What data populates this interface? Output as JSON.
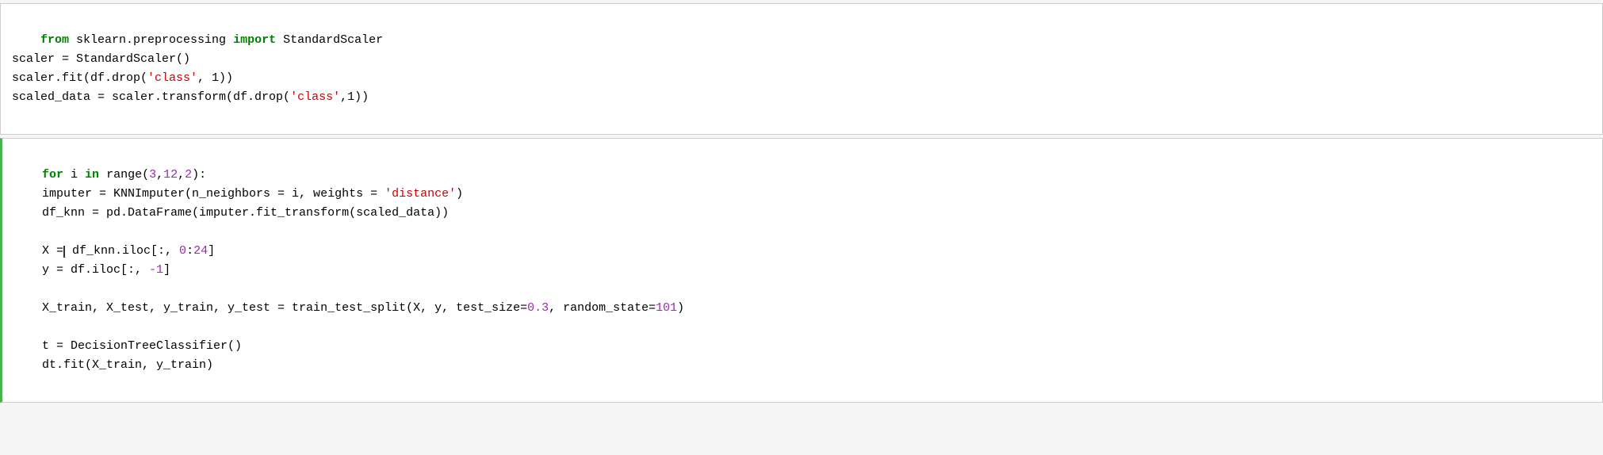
{
  "cells": [
    {
      "id": "cell-1",
      "active": false,
      "lines": []
    },
    {
      "id": "cell-2",
      "active": true,
      "lines": []
    }
  ],
  "cell1": {
    "line1_kw_from": "from",
    "line1_module": " sklearn.preprocessing ",
    "line1_kw_import": "import",
    "line1_class": " StandardScaler",
    "line2": "scaler = StandardScaler()",
    "line3_pre": "scaler.fit(df.drop(",
    "line3_str": "'class'",
    "line3_post": ", 1))",
    "line4_pre": "scaled_data = scaler.transform(df.drop(",
    "line4_str": "'class'",
    "line4_post": ",1))"
  },
  "cell2": {
    "line1_kw_for": "for",
    "line1_mid": " i ",
    "line1_kw_in": "in",
    "line1_range_pre": " range(",
    "line1_num1": "3",
    "line1_comma1": ",",
    "line1_num2": "12",
    "line1_comma2": ",",
    "line1_num3": "2",
    "line1_range_post": "):",
    "line2_pre": "    imputer = KNNImputer(n_neighbors = i, weights = ",
    "line2_str": "'distance'",
    "line2_post": ")",
    "line3": "    df_knn = pd.DataFrame(imputer.fit_transform(scaled_data))",
    "line4_pre": "    X =",
    "line4_cursor": "",
    "line4_post_pre": " df_knn.iloc[:, ",
    "line4_num1": "0",
    "line4_colon": ":",
    "line4_num2": "24",
    "line4_bracket": "]",
    "line5_pre": "    y = df.iloc[:, ",
    "line5_num": "-1",
    "line5_post": "]",
    "line6_pre": "    X_train, X_test, y_train, y_test = train_test_split(X, y, test_size=",
    "line6_num1": "0.3",
    "line6_mid": ", random_state=",
    "line6_num2": "101",
    "line6_post": ")",
    "line7": "    t = DecisionTreeClassifier()",
    "line8": "    dt.fit(X_train, y_train)"
  }
}
